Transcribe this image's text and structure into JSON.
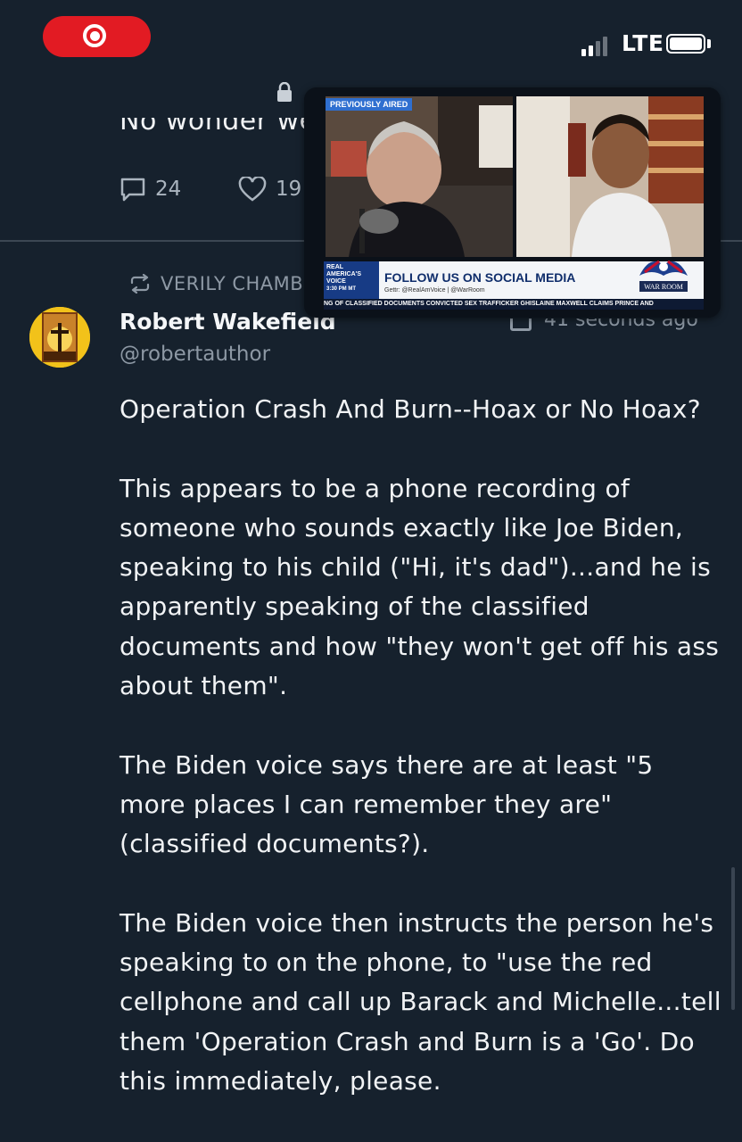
{
  "status_bar": {
    "network": "LTE"
  },
  "previous_post": {
    "text_fragment": "No wonder we",
    "reply_count": "24",
    "like_count": "19"
  },
  "repost": {
    "label": "VERILY CHAMB"
  },
  "post": {
    "author_name": "Robert Wakefield",
    "author_handle": "@robertauthor",
    "timestamp": "41 seconds ago",
    "paragraphs": [
      "Operation Crash And Burn--Hoax or No Hoax?",
      "This appears to be a phone recording of someone who sounds exactly like Joe Biden, speaking to his child (\"Hi, it's dad\")...and he is apparently speaking of the classified documents and how \"they won't get off his ass about them\".",
      "The Biden voice says there are at least \"5 more places I can remember they are\" (classified documents?).",
      "The Biden voice then instructs the person he's speaking to on the phone, to \"use the red cellphone and call up Barack and Michelle...tell them 'Operation Crash and Burn is a 'Go'. Do this immediately, please."
    ]
  },
  "video_overlay": {
    "badge": "PREVIOUSLY AIRED",
    "network_logo_line1": "REAL",
    "network_logo_line2": "AMERICA'S",
    "network_logo_line3": "VOICE",
    "time": "3:30 PM MT",
    "headline": "FOLLOW US ON SOCIAL MEDIA",
    "handles": "Gettr: @RealAmVoice | @WarRoom",
    "ticker": "NG OF CLASSIFIED DOCUMENTS      CONVICTED SEX TRAFFICKER GHISLAINE MAXWELL CLAIMS PRINCE AND",
    "show_logo": "WAR ROOM"
  },
  "colors": {
    "background": "#16212d",
    "record_pill": "#e21b23",
    "muted_text": "#8d98a4",
    "divider": "#3c4753"
  }
}
